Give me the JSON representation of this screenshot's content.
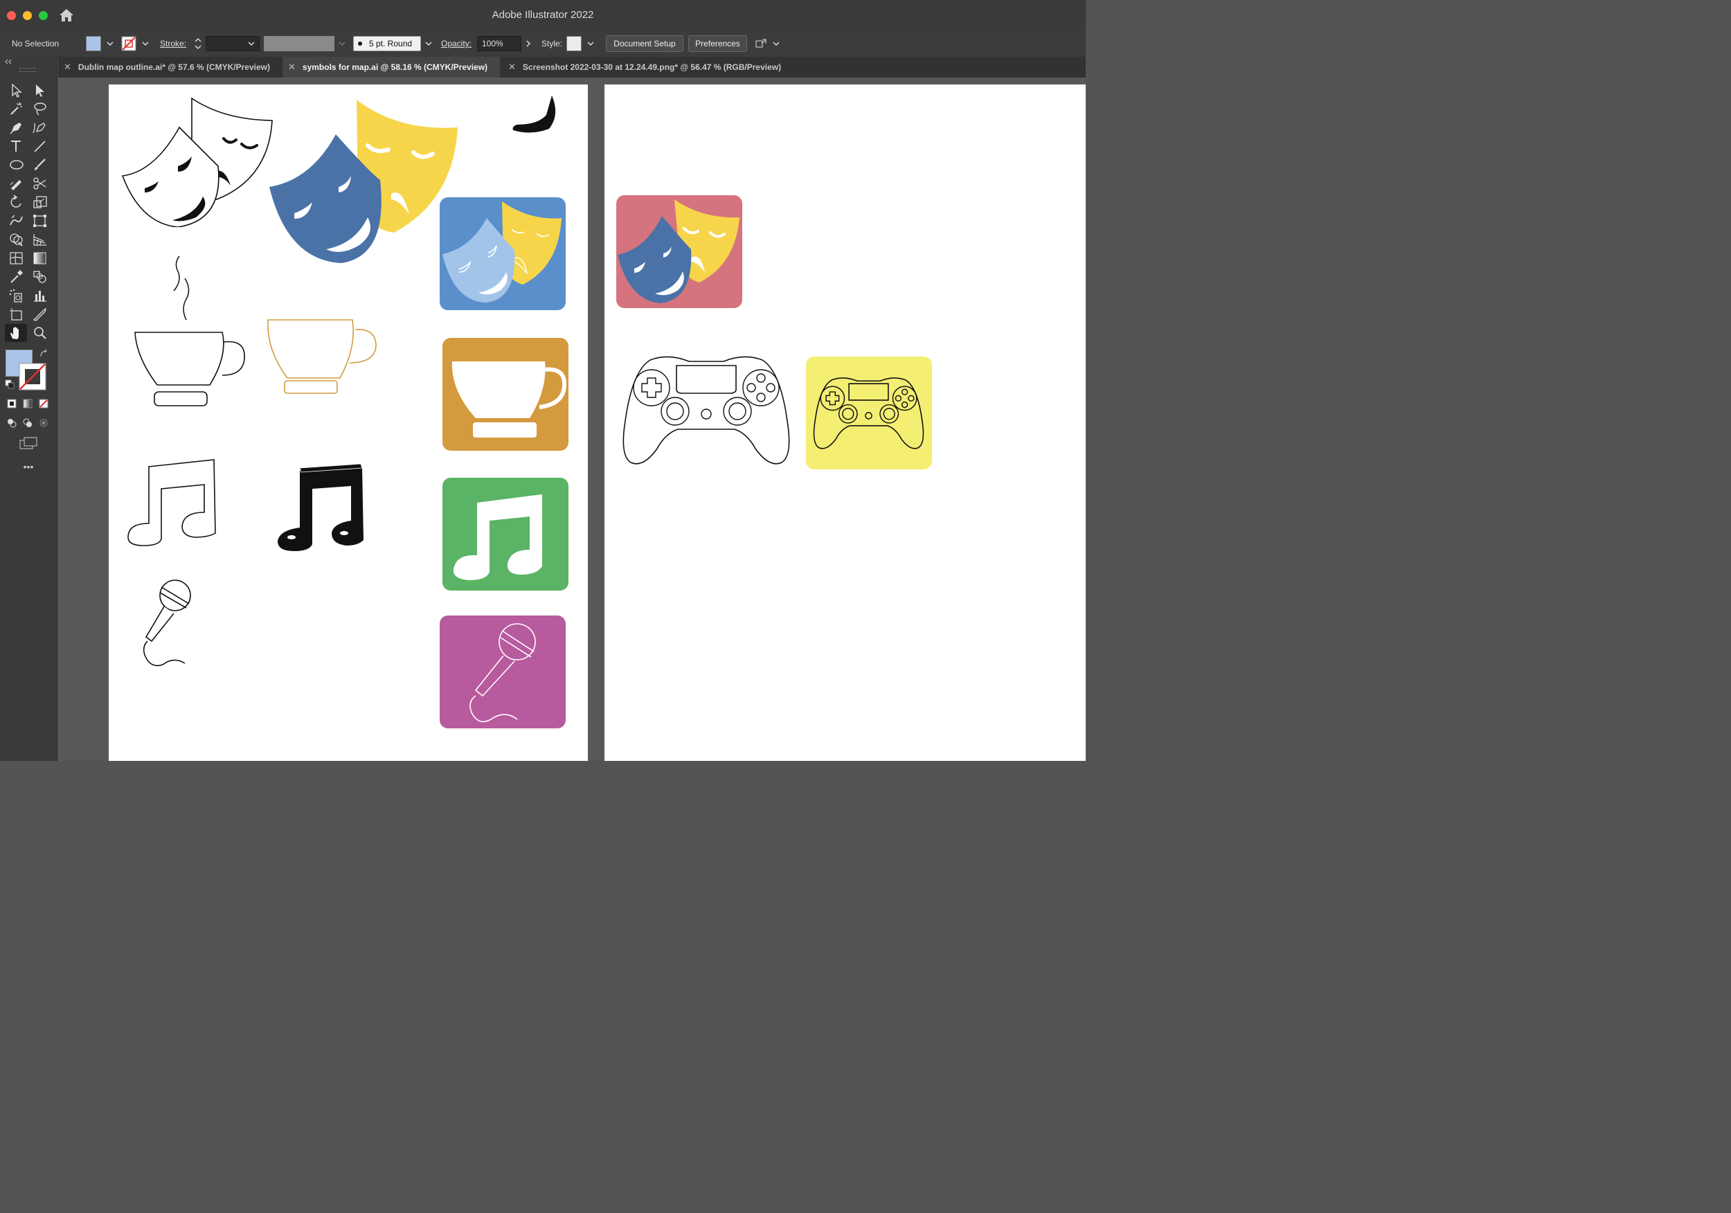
{
  "app": {
    "title": "Adobe Illustrator 2022"
  },
  "control_bar": {
    "selection": "No Selection",
    "fill_color": "#a9c4e8",
    "stroke_label": "Stroke:",
    "stroke_value": "",
    "brush_label": "5 pt. Round",
    "opacity_label": "Opacity:",
    "opacity_value": "100%",
    "style_label": "Style:",
    "document_setup": "Document Setup",
    "preferences": "Preferences"
  },
  "tabs": [
    {
      "label": "Dublin map outline.ai* @ 57.6 % (CMYK/Preview)",
      "active": false
    },
    {
      "label": "symbols for map.ai @ 58.16 % (CMYK/Preview)",
      "active": true
    },
    {
      "label": "Screenshot 2022-03-30 at 12.24.49.png* @ 56.47 % (RGB/Preview)",
      "active": false
    }
  ],
  "toolbar": {
    "tools": [
      "selection-tool",
      "direct-selection-tool",
      "magic-wand-tool",
      "lasso-tool",
      "pen-tool",
      "curvature-tool",
      "type-tool",
      "line-segment-tool",
      "ellipse-tool",
      "paintbrush-tool",
      "shaper-tool",
      "scissors-tool",
      "rotate-tool",
      "scale-tool",
      "warp-tool",
      "free-transform-tool",
      "shape-builder-tool",
      "perspective-grid-tool",
      "mesh-tool",
      "gradient-tool",
      "eyedropper-tool",
      "blend-tool",
      "symbol-sprayer-tool",
      "column-graph-tool",
      "artboard-tool",
      "slice-tool",
      "hand-tool",
      "zoom-tool"
    ],
    "fill_color": "#a9c4e8",
    "more_label": "•••"
  },
  "colors": {
    "mask_blue": "#4a72a6",
    "mask_yellow": "#f7d54a",
    "tile_blue": "#5b8fcb",
    "tile_orange": "#d49a3e",
    "tile_green": "#5bb365",
    "tile_purple": "#b85a9e",
    "tile_pink": "#d5747e",
    "tile_yellow": "#f4ee73",
    "cup_outline_orange": "#d49a3e"
  }
}
